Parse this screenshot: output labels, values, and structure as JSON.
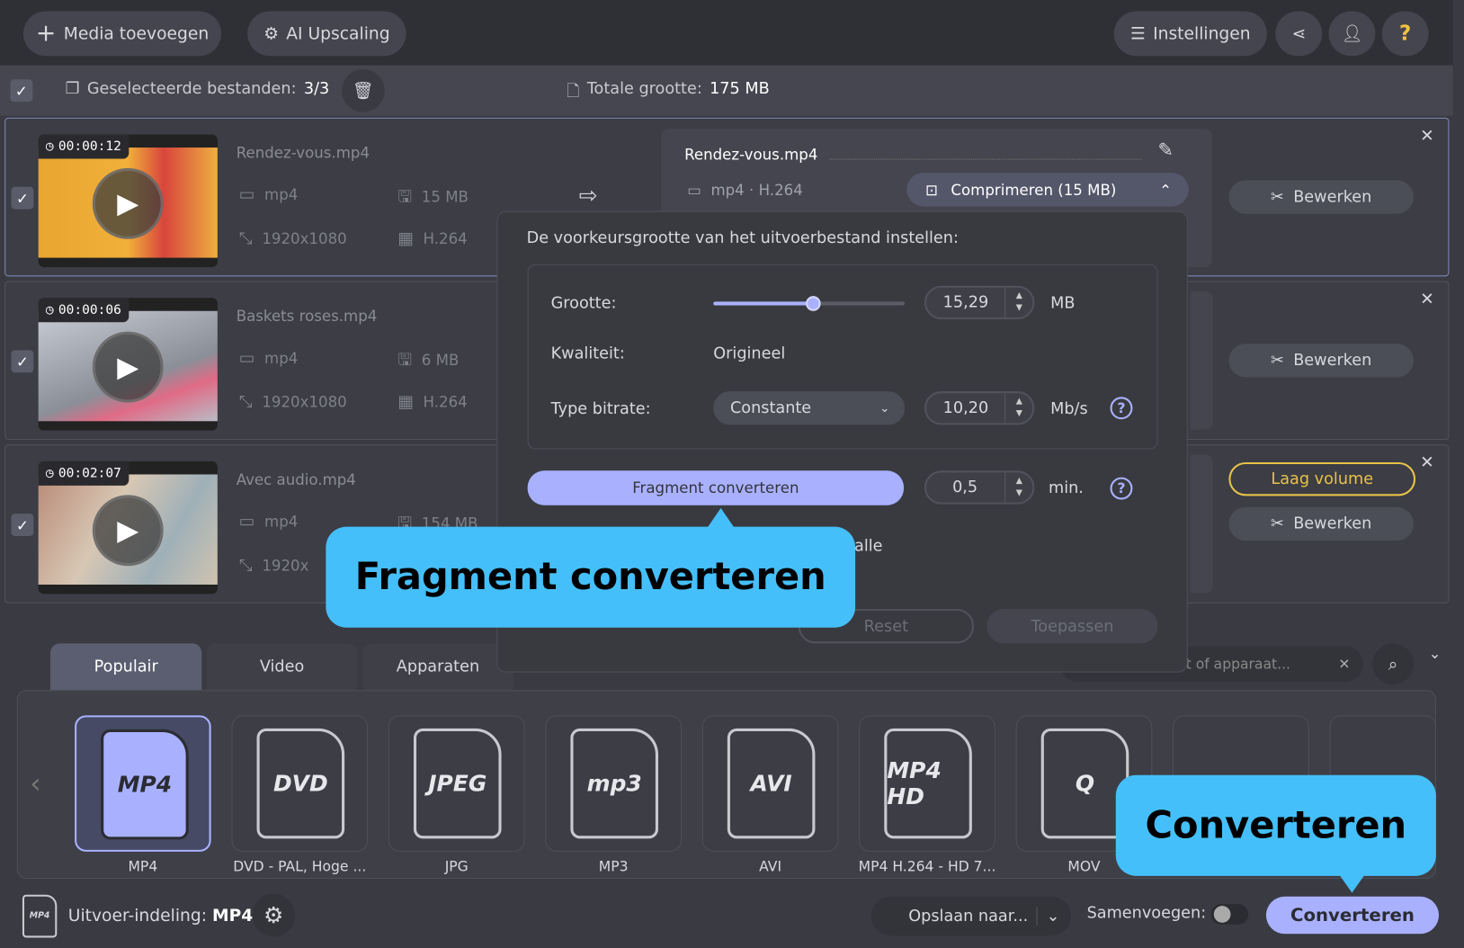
{
  "toolbar": {
    "add_media": "Media toevoegen",
    "ai_upscaling": "AI Upscaling",
    "settings": "Instellingen"
  },
  "selection": {
    "label": "Geselecteerde bestanden:",
    "count": "3/3",
    "total_label": "Totale grootte:",
    "total_value": "175 MB"
  },
  "files": [
    {
      "duration": "00:00:12",
      "name": "Rendez-vous.mp4",
      "container": "mp4",
      "size": "15 MB",
      "resolution": "1920x1080",
      "codec": "H.264",
      "edit": "Bewerken"
    },
    {
      "duration": "00:00:06",
      "name": "Baskets roses.mp4",
      "container": "mp4",
      "size": "6 MB",
      "resolution": "1920x1080",
      "codec": "H.264",
      "edit": "Bewerken"
    },
    {
      "duration": "00:02:07",
      "name": "Avec audio.mp4",
      "container": "mp4",
      "size": "154 MB",
      "resolution": "1920x",
      "codec": "",
      "edit": "Bewerken",
      "badge": "Laag volume"
    }
  ],
  "output": {
    "name": "Rendez-vous.mp4",
    "format": "mp4 · H.264",
    "compress": "Comprimeren (15 MB)"
  },
  "dialog": {
    "title": "De voorkeursgrootte van het uitvoerbestand instellen:",
    "size_label": "Grootte:",
    "size_value": "15,29",
    "size_unit": "MB",
    "size_fraction": 0.52,
    "quality_label": "Kwaliteit:",
    "quality_value": "Origineel",
    "bitrate_label": "Type bitrate:",
    "bitrate_type": "Constante",
    "bitrate_value": "10,20",
    "bitrate_unit": "Mb/s",
    "fragment_button": "Fragment converteren",
    "fragment_value": "0,5",
    "fragment_unit": "min.",
    "partial_text": "alle",
    "reset": "Reset",
    "apply": "Toepassen"
  },
  "callouts": {
    "fragment": "Fragment converteren",
    "convert": "Converteren"
  },
  "tabs": [
    "Populair",
    "Video",
    "Apparaten"
  ],
  "search": {
    "placeholder": "t of apparaat..."
  },
  "formats": [
    {
      "icon": "MP4",
      "label": "MP4"
    },
    {
      "icon": "DVD",
      "label": "DVD - PAL, Hoge ..."
    },
    {
      "icon": "JPEG",
      "label": "JPG"
    },
    {
      "icon": "mp3",
      "label": "MP3"
    },
    {
      "icon": "AVI",
      "label": "AVI"
    },
    {
      "icon": "MP4 HD",
      "label": "MP4 H.264 - HD 7..."
    },
    {
      "icon": "Q",
      "label": "MOV"
    }
  ],
  "bottom": {
    "format_label": "Uitvoer-indeling:",
    "format_value": "MP4",
    "save_to": "Opslaan naar...",
    "merge": "Samenvoegen:",
    "convert": "Converteren"
  },
  "colors": {
    "accent": "#a9b1ff",
    "callout": "#45bff9",
    "warning": "#e8c24a"
  }
}
